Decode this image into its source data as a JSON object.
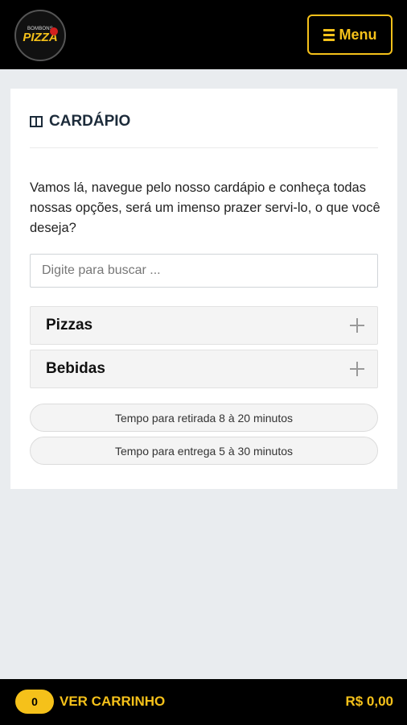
{
  "header": {
    "logo_text_small": "BOMBONS",
    "logo_text_big": "PIZZA",
    "menu_label": "Menu"
  },
  "menu_card": {
    "title": "CARDÁPIO",
    "intro": "Vamos lá, navegue pelo nosso cardápio e conheça todas nossas opções, será um imenso prazer servi-lo, o que você deseja?",
    "search_placeholder": "Digite para buscar ...",
    "categories": [
      {
        "label": "Pizzas"
      },
      {
        "label": "Bebidas"
      }
    ],
    "info": [
      {
        "text": "Tempo para retirada 8 à 20 minutos"
      },
      {
        "text": "Tempo para entrega 5 à 30 minutos"
      }
    ]
  },
  "cart": {
    "count": "0",
    "label": "VER CARRINHO",
    "total": "R$ 0,00"
  },
  "colors": {
    "accent": "#f5c11a",
    "bar": "#000000",
    "background": "#e9ecef"
  }
}
